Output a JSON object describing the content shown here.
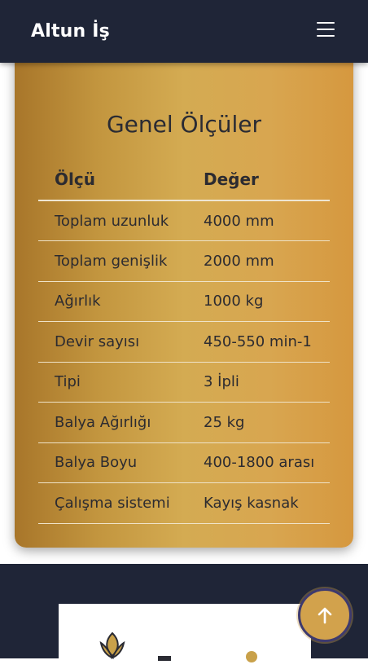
{
  "header": {
    "brand": "Altun İş",
    "menu_icon": "hamburger-menu-icon"
  },
  "section": {
    "title": "Genel Ölçüler",
    "table": {
      "headers": [
        "Ölçü",
        "Değer"
      ],
      "rows": [
        [
          "Toplam uzunluk",
          "4000 mm"
        ],
        [
          "Toplam genişlik",
          "2000 mm"
        ],
        [
          "Ağırlık",
          "1000 kg"
        ],
        [
          "Devir sayısı",
          "450-550 min-1"
        ],
        [
          "Tipi",
          "3 İpli"
        ],
        [
          "Balya Ağırlığı",
          "25 kg"
        ],
        [
          "Balya Boyu",
          "400-1800 arası"
        ],
        [
          "Çalışma sistemi",
          "Kayış kasnak"
        ]
      ]
    }
  },
  "footer": {
    "logo_icon": "company-logo-icon"
  },
  "back_to_top": {
    "icon": "arrow-up-icon"
  },
  "colors": {
    "navbar": "#1f2537",
    "card_gold": "#d4ab52",
    "text_dark": "#2a2b33",
    "back_to_top": "#d2a24c"
  }
}
